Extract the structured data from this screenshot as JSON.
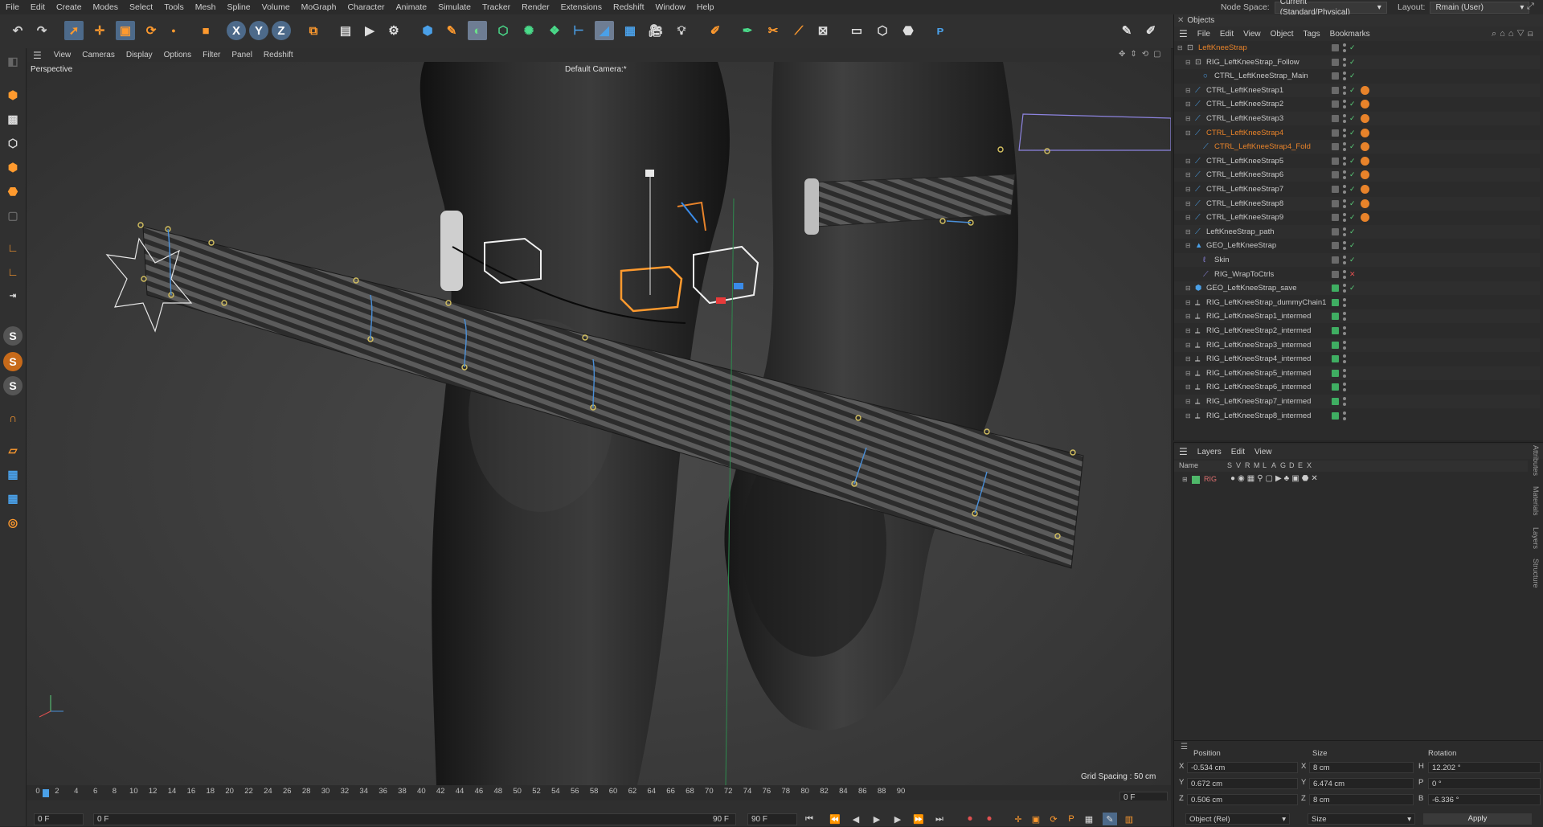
{
  "menu": [
    "File",
    "Edit",
    "Create",
    "Modes",
    "Select",
    "Tools",
    "Mesh",
    "Spline",
    "Volume",
    "MoGraph",
    "Character",
    "Animate",
    "Simulate",
    "Tracker",
    "Render",
    "Extensions",
    "Redshift",
    "Window",
    "Help"
  ],
  "node_space": {
    "label": "Node Space:",
    "value": "Current (Standard/Physical)"
  },
  "layout": {
    "label": "Layout:",
    "value": "Rmain (User)"
  },
  "viewport": {
    "menu": [
      "View",
      "Cameras",
      "Display",
      "Options",
      "Filter",
      "Panel",
      "Redshift"
    ],
    "name": "Perspective",
    "camera": "Default Camera",
    "camera_mark": ":*",
    "grid_spacing": "Grid Spacing : 50 cm"
  },
  "toolbar_axes": [
    "X",
    "Y",
    "Z"
  ],
  "timeline": {
    "ticks": [
      "0",
      "2",
      "4",
      "6",
      "8",
      "10",
      "12",
      "14",
      "16",
      "18",
      "20",
      "22",
      "24",
      "26",
      "28",
      "30",
      "32",
      "34",
      "36",
      "38",
      "40",
      "42",
      "44",
      "46",
      "48",
      "50",
      "52",
      "54",
      "56",
      "58",
      "60",
      "62",
      "64",
      "66",
      "68",
      "70",
      "72",
      "74",
      "76",
      "78",
      "80",
      "82",
      "84",
      "86",
      "88",
      "90"
    ],
    "current_frame": "0 F",
    "start_field": "0 F",
    "min_field": "0 F",
    "end_field": "90 F",
    "max_field": "90 F"
  },
  "objects": {
    "title": "Objects",
    "menu": [
      "File",
      "Edit",
      "View",
      "Object",
      "Tags",
      "Bookmarks"
    ],
    "rows": [
      {
        "name": "LeftKneeStrap",
        "indent": 0,
        "color": "#e8832a",
        "icon": "null-icon"
      },
      {
        "name": "RIG_LeftKneeStrap_Follow",
        "indent": 1,
        "color": "#c8c8c8",
        "icon": "null-icon"
      },
      {
        "name": "CTRL_LeftKneeStrap_Main",
        "indent": 2,
        "color": "#c8c8c8",
        "icon": "circle-icon"
      },
      {
        "name": "CTRL_LeftKneeStrap1",
        "indent": 1,
        "color": "#c8c8c8",
        "icon": "spline-icon"
      },
      {
        "name": "CTRL_LeftKneeStrap2",
        "indent": 1,
        "color": "#c8c8c8",
        "icon": "spline-icon"
      },
      {
        "name": "CTRL_LeftKneeStrap3",
        "indent": 1,
        "color": "#c8c8c8",
        "icon": "spline-icon"
      },
      {
        "name": "CTRL_LeftKneeStrap4",
        "indent": 1,
        "color": "#e8832a",
        "icon": "spline-icon"
      },
      {
        "name": "CTRL_LeftKneeStrap4_Fold",
        "indent": 2,
        "color": "#e8832a",
        "icon": "spline-icon"
      },
      {
        "name": "CTRL_LeftKneeStrap5",
        "indent": 1,
        "color": "#c8c8c8",
        "icon": "spline-icon"
      },
      {
        "name": "CTRL_LeftKneeStrap6",
        "indent": 1,
        "color": "#c8c8c8",
        "icon": "spline-icon"
      },
      {
        "name": "CTRL_LeftKneeStrap7",
        "indent": 1,
        "color": "#c8c8c8",
        "icon": "spline-icon"
      },
      {
        "name": "CTRL_LeftKneeStrap8",
        "indent": 1,
        "color": "#c8c8c8",
        "icon": "spline-icon"
      },
      {
        "name": "CTRL_LeftKneeStrap9",
        "indent": 1,
        "color": "#c8c8c8",
        "icon": "spline-icon"
      },
      {
        "name": "LeftKneeStrap_path",
        "indent": 1,
        "color": "#c8c8c8",
        "icon": "spline-icon"
      },
      {
        "name": "GEO_LeftKneeStrap",
        "indent": 1,
        "color": "#c8c8c8",
        "icon": "mesh-icon"
      },
      {
        "name": "Skin",
        "indent": 2,
        "color": "#c8c8c8",
        "icon": "skin-icon"
      },
      {
        "name": "RIG_WrapToCtrls",
        "indent": 2,
        "color": "#c8c8c8",
        "icon": "deformer-icon"
      },
      {
        "name": "GEO_LeftKneeStrap_save",
        "indent": 1,
        "color": "#c8c8c8",
        "icon": "poly-icon"
      },
      {
        "name": "RIG_LeftKneeStrap_dummyChain1",
        "indent": 1,
        "color": "#c8c8c8",
        "icon": "joint-icon"
      },
      {
        "name": "RIG_LeftKneeStrap1_intermed",
        "indent": 1,
        "color": "#c8c8c8",
        "icon": "joint-icon"
      },
      {
        "name": "RIG_LeftKneeStrap2_intermed",
        "indent": 1,
        "color": "#c8c8c8",
        "icon": "joint-icon"
      },
      {
        "name": "RIG_LeftKneeStrap3_intermed",
        "indent": 1,
        "color": "#c8c8c8",
        "icon": "joint-icon"
      },
      {
        "name": "RIG_LeftKneeStrap4_intermed",
        "indent": 1,
        "color": "#c8c8c8",
        "icon": "joint-icon"
      },
      {
        "name": "RIG_LeftKneeStrap5_intermed",
        "indent": 1,
        "color": "#c8c8c8",
        "icon": "joint-icon"
      },
      {
        "name": "RIG_LeftKneeStrap6_intermed",
        "indent": 1,
        "color": "#c8c8c8",
        "icon": "joint-icon"
      },
      {
        "name": "RIG_LeftKneeStrap7_intermed",
        "indent": 1,
        "color": "#c8c8c8",
        "icon": "joint-icon"
      },
      {
        "name": "RIG_LeftKneeStrap8_intermed",
        "indent": 1,
        "color": "#c8c8c8",
        "icon": "joint-icon"
      }
    ]
  },
  "layers": {
    "title": "Layers",
    "menu": [
      "Layers",
      "Edit",
      "View"
    ],
    "columns": [
      "Name",
      "S",
      "V",
      "R",
      "M",
      "L",
      "A",
      "G",
      "D",
      "E",
      "X"
    ],
    "rows": [
      {
        "name": "RIG",
        "color": "#4fb86a"
      }
    ]
  },
  "side_tabs": [
    "Attributes",
    "Materials",
    "Layers",
    "Structure"
  ],
  "coords": {
    "headers": {
      "position": "Position",
      "size": "Size",
      "rotation": "Rotation"
    },
    "rows": [
      {
        "axis": "X",
        "pos": "-0.534 cm",
        "size_axis": "X",
        "size": "8 cm",
        "rot_axis": "H",
        "rot": "12.202 °"
      },
      {
        "axis": "Y",
        "pos": "0.672 cm",
        "size_axis": "Y",
        "size": "6.474 cm",
        "rot_axis": "P",
        "rot": "0 °"
      },
      {
        "axis": "Z",
        "pos": "0.506 cm",
        "size_axis": "Z",
        "size": "8 cm",
        "rot_axis": "B",
        "rot": "-6.336 °"
      }
    ],
    "mode": "Object (Rel)",
    "size_mode": "Size",
    "apply": "Apply"
  }
}
